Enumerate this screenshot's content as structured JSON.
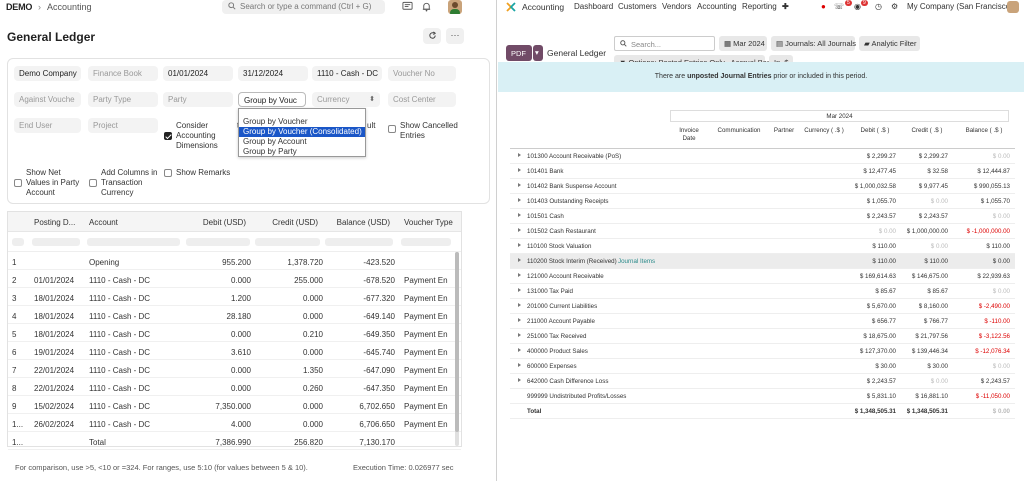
{
  "left": {
    "top": {
      "logo": "DEMO",
      "breadcrumb": "Accounting",
      "search_placeholder": "Search or type a command (Ctrl + G)"
    },
    "page_title": "General Ledger",
    "filters": {
      "company": "Demo Company",
      "finance_book": "Finance Book",
      "from_date": "01/01/2024",
      "to_date": "31/12/2024",
      "account": "1110 - Cash - DC",
      "voucher_no": "Voucher No",
      "against_voucher": "Against Vouche",
      "party_type": "Party Type",
      "party": "Party",
      "group_by": "Group by Vouc",
      "currency": "Currency",
      "cost_center": "Cost Center",
      "end_user": "End User",
      "project": "Project",
      "fragment_t": "t",
      "fragment_ult": "ult",
      "consider_dimensions": "Consider Accounting Dimensions",
      "show_cancelled": "Show Cancelled Entries",
      "show_net_values": "Show Net Values in Party Account",
      "add_columns": "Add Columns in Transaction Currency",
      "show_remarks": "Show Remarks"
    },
    "group_by_options": [
      "Group by Voucher",
      "Group by Voucher (Consolidated)",
      "Group by Account",
      "Group by Party"
    ],
    "columns": [
      "Posting D...",
      "Account",
      "Debit (USD)",
      "Credit (USD)",
      "Balance (USD)",
      "Voucher Type"
    ],
    "rows": [
      {
        "n": "1",
        "date": "",
        "account": "Opening",
        "debit": "955.200",
        "credit": "1,378.720",
        "balance": "-423.520",
        "vtype": ""
      },
      {
        "n": "2",
        "date": "01/01/2024",
        "account": "1110 - Cash - DC",
        "debit": "0.000",
        "credit": "255.000",
        "balance": "-678.520",
        "vtype": "Payment En"
      },
      {
        "n": "3",
        "date": "18/01/2024",
        "account": "1110 - Cash - DC",
        "debit": "1.200",
        "credit": "0.000",
        "balance": "-677.320",
        "vtype": "Payment En"
      },
      {
        "n": "4",
        "date": "18/01/2024",
        "account": "1110 - Cash - DC",
        "debit": "28.180",
        "credit": "0.000",
        "balance": "-649.140",
        "vtype": "Payment En"
      },
      {
        "n": "5",
        "date": "18/01/2024",
        "account": "1110 - Cash - DC",
        "debit": "0.000",
        "credit": "0.210",
        "balance": "-649.350",
        "vtype": "Payment En"
      },
      {
        "n": "6",
        "date": "19/01/2024",
        "account": "1110 - Cash - DC",
        "debit": "3.610",
        "credit": "0.000",
        "balance": "-645.740",
        "vtype": "Payment En"
      },
      {
        "n": "7",
        "date": "22/01/2024",
        "account": "1110 - Cash - DC",
        "debit": "0.000",
        "credit": "1.350",
        "balance": "-647.090",
        "vtype": "Payment En"
      },
      {
        "n": "8",
        "date": "22/01/2024",
        "account": "1110 - Cash - DC",
        "debit": "0.000",
        "credit": "0.260",
        "balance": "-647.350",
        "vtype": "Payment En"
      },
      {
        "n": "9",
        "date": "15/02/2024",
        "account": "1110 - Cash - DC",
        "debit": "7,350.000",
        "credit": "0.000",
        "balance": "6,702.650",
        "vtype": "Payment En"
      },
      {
        "n": "1...",
        "date": "26/02/2024",
        "account": "1110 - Cash - DC",
        "debit": "4.000",
        "credit": "0.000",
        "balance": "6,706.650",
        "vtype": "Payment En"
      },
      {
        "n": "1...",
        "date": "",
        "account": "Total",
        "debit": "7,386.990",
        "credit": "256.820",
        "balance": "7,130.170",
        "vtype": ""
      }
    ],
    "footer_hint": "For comparison, use >5, <10 or =324. For ranges, use 5:10 (for values between 5 & 10).",
    "footer_exec": "Execution Time: 0.026977 sec"
  },
  "right": {
    "nav": {
      "app": "Accounting",
      "menu": [
        "Dashboard",
        "Customers",
        "Vendors",
        "Accounting",
        "Reporting"
      ],
      "badge_a": "5",
      "badge_b": "9",
      "company": "My Company (San Francisco)"
    },
    "controls": {
      "pdf": "PDF",
      "report_title": "General Ledger",
      "search_placeholder": "Search...",
      "date_filter": "Mar 2024",
      "journals": "Journals: All Journals",
      "analytic": "Analytic Filter",
      "options": "Options: Posted Entries Only , Accrual Basis",
      "currency": "In .$"
    },
    "banner": {
      "pre": "There are ",
      "bold": "unposted Journal Entries",
      "post": " prior or included in this period."
    },
    "period": "Mar 2024",
    "columns": [
      "Invoice Date",
      "Communication",
      "Partner",
      "Currency ( .$ )",
      "Debit ( .$ )",
      "Credit ( .$ )",
      "Balance ( .$ )"
    ],
    "rows": [
      {
        "name": "101300 Account Receivable (PoS)",
        "debit": "$ 2,299.27",
        "credit": "$ 2,299.27",
        "balance": "$ 0.00",
        "bal_style": "zero"
      },
      {
        "name": "101401 Bank",
        "debit": "$ 12,477.45",
        "credit": "$ 32.58",
        "balance": "$ 12,444.87",
        "bal_style": ""
      },
      {
        "name": "101402 Bank Suspense Account",
        "debit": "$ 1,000,032.58",
        "credit": "$ 9,977.45",
        "balance": "$ 990,055.13",
        "bal_style": ""
      },
      {
        "name": "101403 Outstanding Receipts",
        "debit": "$ 1,055.70",
        "credit": "$ 0.00",
        "balance": "$ 1,055.70",
        "bal_style": "",
        "cr_style": "zero"
      },
      {
        "name": "101501 Cash",
        "debit": "$ 2,243.57",
        "credit": "$ 2,243.57",
        "balance": "$ 0.00",
        "bal_style": "zero"
      },
      {
        "name": "101502 Cash Restaurant",
        "debit": "$ 0.00",
        "credit": "$ 1,000,000.00",
        "balance": "$ -1,000,000.00",
        "bal_style": "neg",
        "dr_style": "zero"
      },
      {
        "name": "110100 Stock Valuation",
        "debit": "$ 110.00",
        "credit": "$ 0.00",
        "balance": "$ 110.00",
        "bal_style": "",
        "cr_style": "zero"
      },
      {
        "name": "110200 Stock Interim (Received)",
        "tag": "Journal Items",
        "debit": "$ 110.00",
        "credit": "$ 110.00",
        "balance": "$ 0.00",
        "bal_style": "",
        "hover": true
      },
      {
        "name": "121000 Account Receivable",
        "debit": "$ 169,614.63",
        "credit": "$ 146,675.00",
        "balance": "$ 22,939.63",
        "bal_style": ""
      },
      {
        "name": "131000 Tax Paid",
        "debit": "$ 85.67",
        "credit": "$ 85.67",
        "balance": "$ 0.00",
        "bal_style": "zero"
      },
      {
        "name": "201000 Current Liabilities",
        "debit": "$ 5,670.00",
        "credit": "$ 8,160.00",
        "balance": "$ -2,490.00",
        "bal_style": "neg"
      },
      {
        "name": "211000 Account Payable",
        "debit": "$ 656.77",
        "credit": "$ 766.77",
        "balance": "$ -110.00",
        "bal_style": "neg"
      },
      {
        "name": "251000 Tax Received",
        "debit": "$ 18,675.00",
        "credit": "$ 21,797.56",
        "balance": "$ -3,122.56",
        "bal_style": "neg"
      },
      {
        "name": "400000 Product Sales",
        "debit": "$ 127,370.00",
        "credit": "$ 139,446.34",
        "balance": "$ -12,076.34",
        "bal_style": "neg"
      },
      {
        "name": "600000 Expenses",
        "debit": "$ 30.00",
        "credit": "$ 30.00",
        "balance": "$ 0.00",
        "bal_style": "zero"
      },
      {
        "name": "642000 Cash Difference Loss",
        "debit": "$ 2,243.57",
        "credit": "$ 0.00",
        "balance": "$ 2,243.57",
        "bal_style": "",
        "cr_style": "zero"
      },
      {
        "name": "999999 Undistributed Profits/Losses",
        "debit": "$ 5,831.10",
        "credit": "$ 16,881.10",
        "balance": "$ -11,050.00",
        "bal_style": "neg",
        "noarrow": true
      },
      {
        "name": "Total",
        "debit": "$ 1,348,505.31",
        "credit": "$ 1,348,505.31",
        "balance": "$ 0.00",
        "bal_style": "zero",
        "noarrow": true,
        "bold": true
      }
    ]
  },
  "colors": {
    "odoo_purple": "#714b67",
    "banner_bg": "#d9f0f5",
    "dropdown_highlight": "#1a56c7",
    "negative": "#dd0000"
  }
}
